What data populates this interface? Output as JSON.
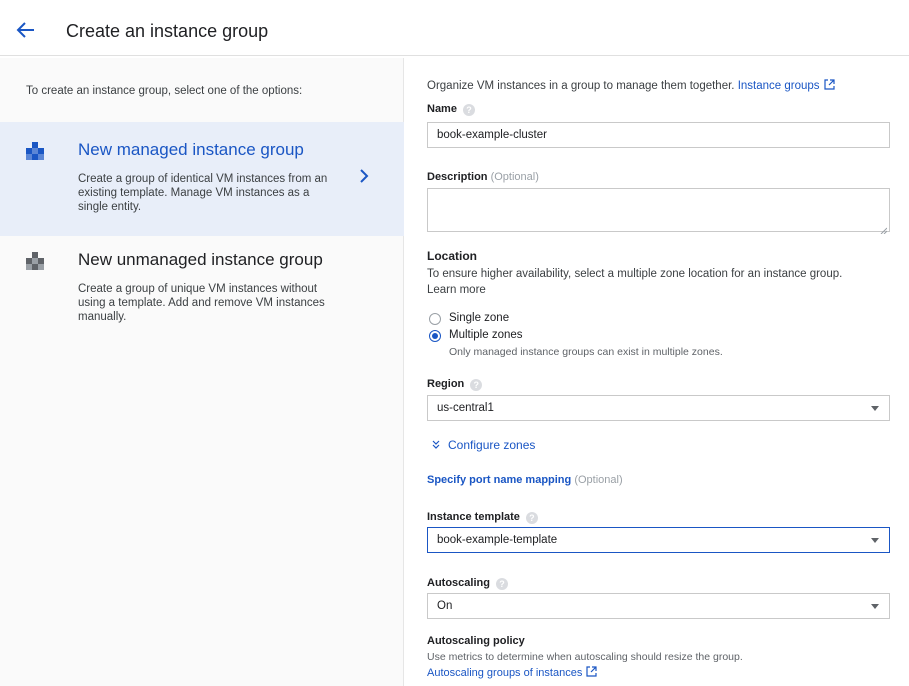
{
  "header": {
    "title": "Create an instance group"
  },
  "left": {
    "intro": "To create an instance group, select one of the options:",
    "options": [
      {
        "title": "New managed instance group",
        "description": "Create a group of identical VM instances from an existing template. Manage VM instances as a single entity."
      },
      {
        "title": "New unmanaged instance group",
        "description": "Create a group of unique VM instances without using a template. Add and remove VM instances manually."
      }
    ]
  },
  "form": {
    "intro": "Organize VM instances in a group to manage them together.",
    "intro_link": "Instance groups",
    "name": {
      "label": "Name",
      "help": "?",
      "value": "book-example-cluster"
    },
    "description": {
      "label": "Description",
      "optional": "(Optional)",
      "value": ""
    },
    "location": {
      "title": "Location",
      "help_text": "To ensure higher availability, select a multiple zone location for an instance group.",
      "learn_more": "Learn more",
      "options": [
        {
          "label": "Single zone",
          "checked": false
        },
        {
          "label": "Multiple zones",
          "checked": true
        }
      ],
      "note": "Only managed instance groups can exist in multiple zones."
    },
    "region": {
      "label": "Region",
      "help": "?",
      "value": "us-central1"
    },
    "configure_zones": "Configure zones",
    "port_mapping": {
      "link": "Specify port name mapping",
      "optional": "(Optional)"
    },
    "instance_template": {
      "label": "Instance template",
      "help": "?",
      "value": "book-example-template"
    },
    "autoscaling": {
      "label": "Autoscaling",
      "help": "?",
      "value": "On"
    },
    "autoscaling_policy": {
      "title": "Autoscaling policy",
      "help_text": "Use metrics to determine when autoscaling should resize the group.",
      "link": "Autoscaling groups of instances"
    }
  },
  "colors": {
    "accent": "#1a56c4",
    "selected_bg": "#e8eef9",
    "muted": "#9aa0a6"
  }
}
